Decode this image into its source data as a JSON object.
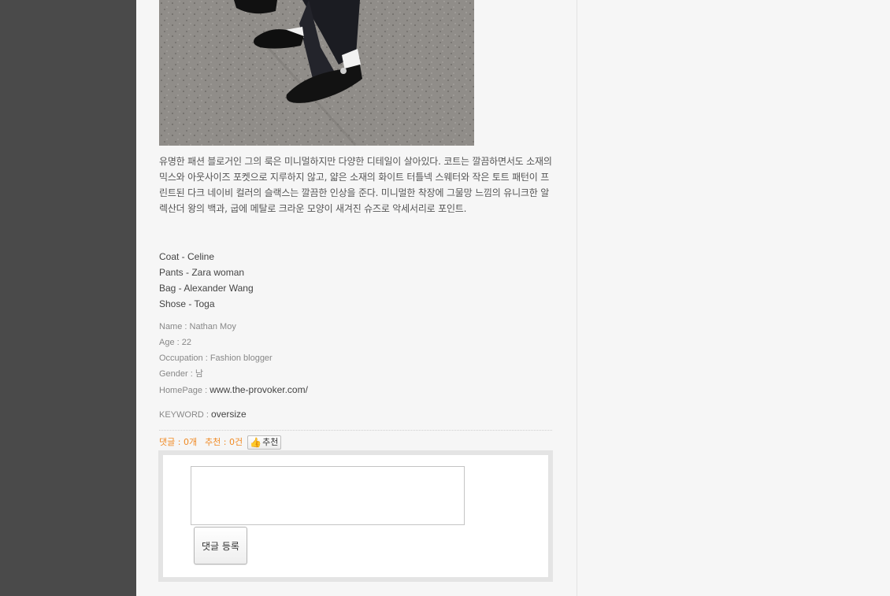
{
  "post": {
    "description": "유명한 패션 블로거인 그의 룩은 미니멀하지만 다양한 디테일이 살아있다. 코트는 깔끔하면서도 소재의 믹스와 아웃사이즈 포켓으로 지루하지 않고, 얇은 소재의 화이트 터틀넥 스웨터와 작은 토트 패턴이 프린트된 다크 네이비 컬러의 슬랙스는 깔끔한 인상을 준다. 미니멀한 착장에 그물망 느낌의 유니크한 알렉산더 왕의 백과, 굽에 메탈로 크라운 모양이 새겨진 슈즈로 악세서리로 포인트.",
    "items": [
      "Coat - Celine",
      "Pants - Zara woman",
      "Bag - Alexander Wang",
      "Shose - Toga"
    ],
    "profile": {
      "name_label": "Name : ",
      "name": "Nathan Moy",
      "age_label": "Age : ",
      "age": "22",
      "occupation_label": "Occupation : ",
      "occupation": "Fashion blogger",
      "gender_label": "Gender : ",
      "gender": "남",
      "homepage_label": "HomePage : ",
      "homepage": "www.the-provoker.com/"
    },
    "keyword_label": "KEYWORD : ",
    "keyword": "oversize"
  },
  "stats": {
    "comments": "댓글 : 0개",
    "recommends": "추천 : 0건",
    "recommend_button": "추천"
  },
  "comment_form": {
    "textarea_value": "",
    "submit_label": "댓글 등록"
  },
  "colors": {
    "sidebar": "#4a4a4a",
    "page_bg": "#f6f6f6",
    "accent_orange": "#f08a24"
  }
}
